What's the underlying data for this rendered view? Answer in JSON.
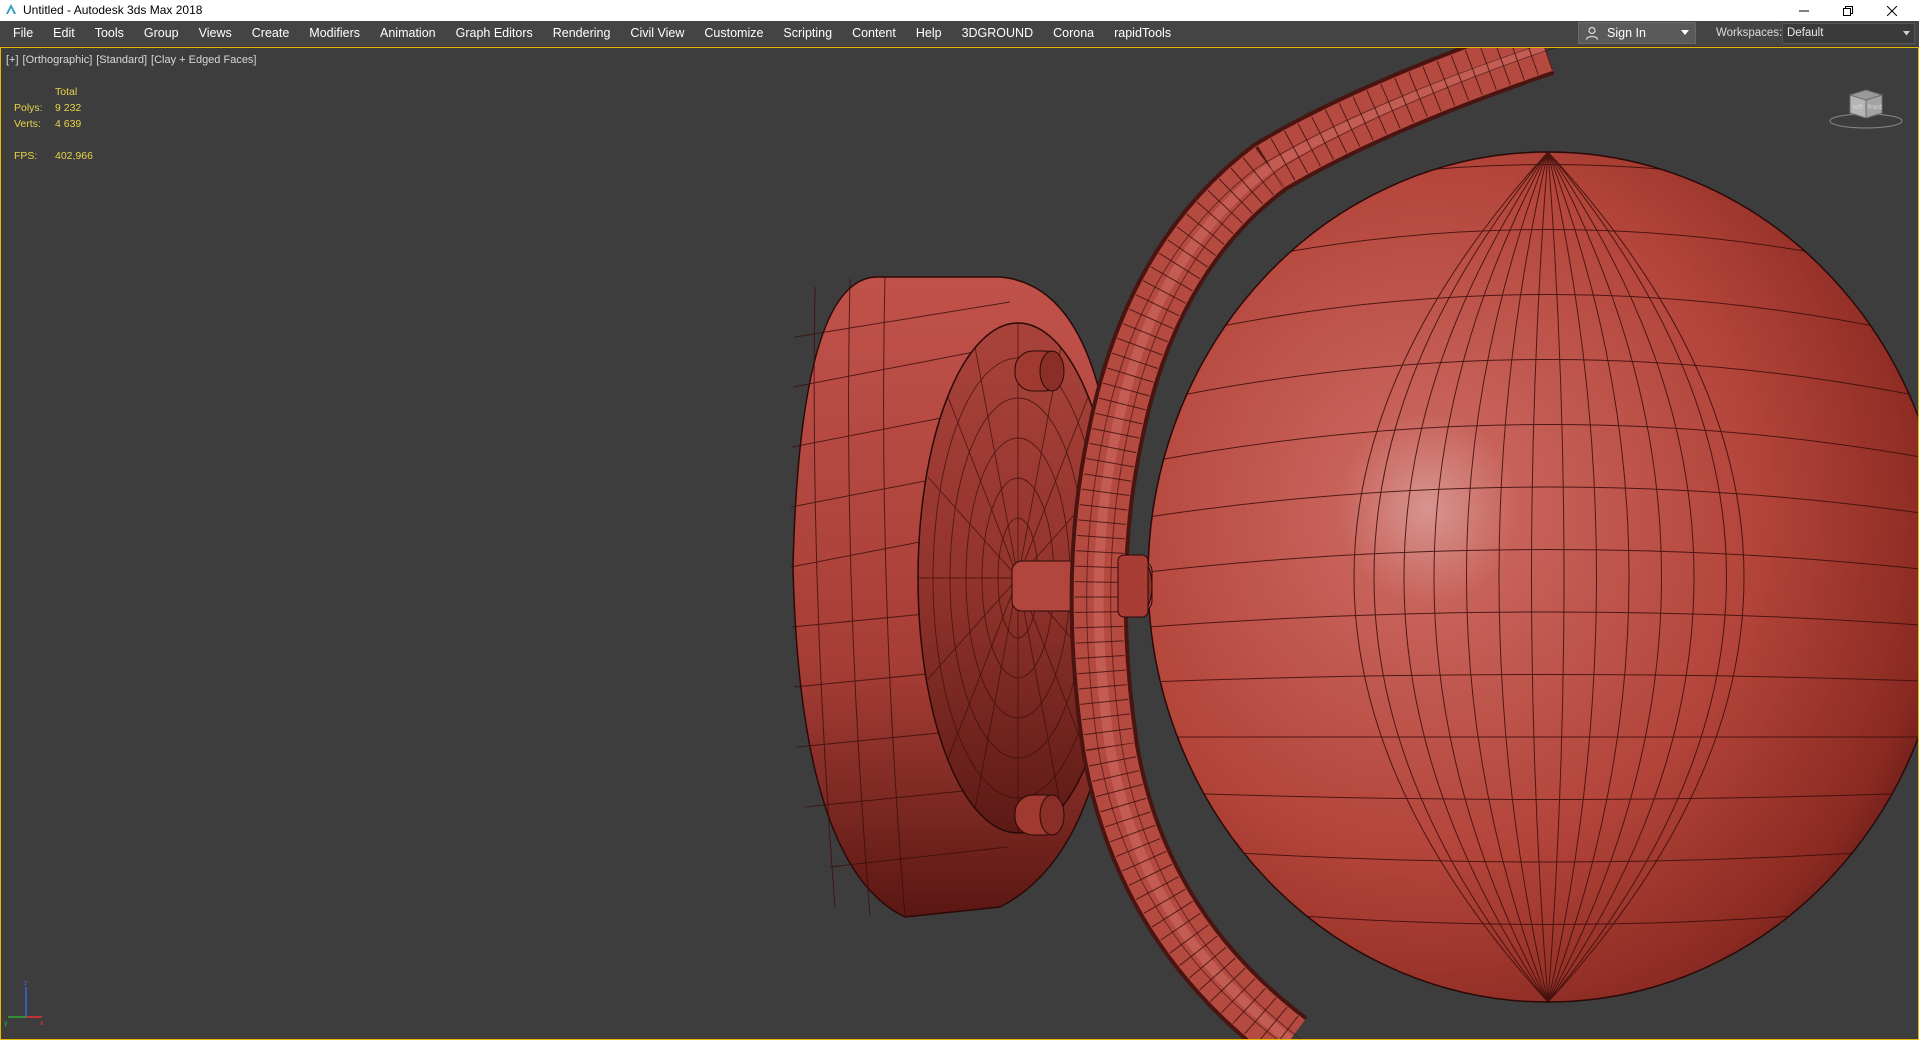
{
  "window": {
    "title": "Untitled - Autodesk 3ds Max 2018",
    "icon": "3dsmax-app-icon"
  },
  "menubar": {
    "items": [
      {
        "label": "File"
      },
      {
        "label": "Edit"
      },
      {
        "label": "Tools"
      },
      {
        "label": "Group"
      },
      {
        "label": "Views"
      },
      {
        "label": "Create"
      },
      {
        "label": "Modifiers"
      },
      {
        "label": "Animation"
      },
      {
        "label": "Graph Editors"
      },
      {
        "label": "Rendering"
      },
      {
        "label": "Civil View"
      },
      {
        "label": "Customize"
      },
      {
        "label": "Scripting"
      },
      {
        "label": "Content"
      },
      {
        "label": "Help"
      },
      {
        "label": "3DGROUND"
      },
      {
        "label": "Corona"
      },
      {
        "label": "rapidTools"
      }
    ],
    "sign_in": "Sign In",
    "workspaces_label": "Workspaces:",
    "workspaces_value": "Default"
  },
  "viewport": {
    "labels": [
      "[+]",
      "[Orthographic]",
      "[Standard]",
      "[Clay + Edged Faces]"
    ],
    "stats": {
      "header": "Total",
      "polys_label": "Polys:",
      "polys_value": "9 232",
      "verts_label": "Verts:",
      "verts_value": "4 639",
      "fps_label": "FPS:",
      "fps_value": "402,966"
    },
    "viewcube_faces": [
      "left",
      "front"
    ],
    "active_border_color": "#e6b800",
    "background_color": "#3d3d3d",
    "clay_color": "#b8473f"
  }
}
